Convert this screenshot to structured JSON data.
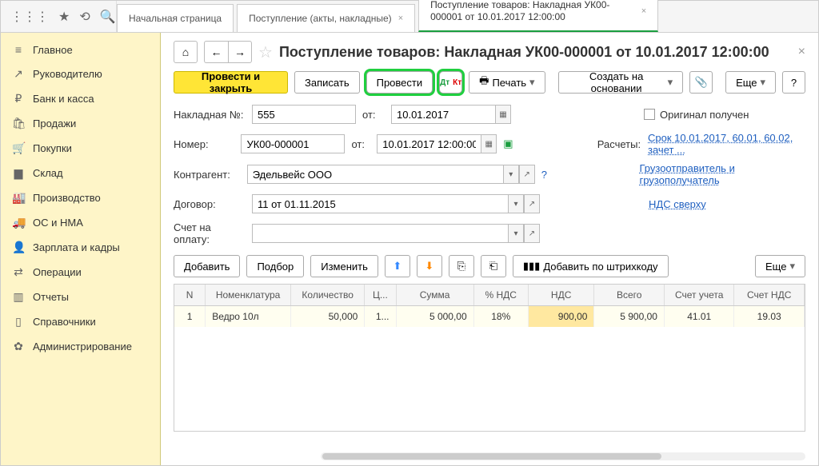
{
  "topbar": {
    "icons": [
      "⋮⋮⋮",
      "★",
      "⟲",
      "🔍"
    ]
  },
  "tabs": [
    {
      "label": "Начальная страница"
    },
    {
      "label": "Поступление (акты, накладные)"
    },
    {
      "label": "Поступление товаров: Накладная УК00-000001 от 10.01.2017 12:00:00",
      "active": true
    }
  ],
  "sidebar": {
    "items": [
      {
        "icon": "≡",
        "label": "Главное"
      },
      {
        "icon": "↗",
        "label": "Руководителю"
      },
      {
        "icon": "₽",
        "label": "Банк и касса"
      },
      {
        "icon": "🛍",
        "label": "Продажи"
      },
      {
        "icon": "🛒",
        "label": "Покупки"
      },
      {
        "icon": "▆",
        "label": "Склад"
      },
      {
        "icon": "🏭",
        "label": "Производство"
      },
      {
        "icon": "🚚",
        "label": "ОС и НМА"
      },
      {
        "icon": "👤",
        "label": "Зарплата и кадры"
      },
      {
        "icon": "⇄",
        "label": "Операции"
      },
      {
        "icon": "▥",
        "label": "Отчеты"
      },
      {
        "icon": "▯",
        "label": "Справочники"
      },
      {
        "icon": "✿",
        "label": "Администрирование"
      }
    ]
  },
  "page": {
    "title": "Поступление товаров: Накладная УК00-000001 от 10.01.2017 12:00:00"
  },
  "toolbar": {
    "post_close": "Провести и закрыть",
    "save": "Записать",
    "post": "Провести",
    "dtkt": "Дт Кт",
    "print": "Печать",
    "create_based": "Создать на основании",
    "more": "Еще",
    "help": "?"
  },
  "form": {
    "invoice_label": "Накладная №:",
    "invoice_no": "555",
    "from_label": "от:",
    "invoice_date": "10.01.2017",
    "original_received": "Оригинал получен",
    "number_label": "Номер:",
    "number": "УК00-000001",
    "number_datetime": "10.01.2017 12:00:00",
    "settlements_label": "Расчеты:",
    "settlements_link": "Срок 10.01.2017, 60.01, 60.02, зачет ...",
    "counterparty_label": "Контрагент:",
    "counterparty": "Эдельвейс ООО",
    "shipper_link": "Грузоотправитель и грузополучатель",
    "contract_label": "Договор:",
    "contract": "11 от 01.11.2015",
    "vat_link": "НДС сверху",
    "bill_label": "Счет на оплату:",
    "bill": ""
  },
  "table_toolbar": {
    "add": "Добавить",
    "select": "Подбор",
    "change": "Изменить",
    "barcode": "Добавить по штрихкоду",
    "more": "Еще"
  },
  "table": {
    "headers": {
      "n": "N",
      "nom": "Номенклатура",
      "qty": "Количество",
      "price": "Ц...",
      "sum": "Сумма",
      "vatp": "% НДС",
      "vat": "НДС",
      "total": "Всего",
      "acc": "Счет учета",
      "vacc": "Счет НДС"
    },
    "rows": [
      {
        "n": "1",
        "nom": "Ведро 10л",
        "qty": "50,000",
        "price": "1...",
        "sum": "5 000,00",
        "vatp": "18%",
        "vat": "900,00",
        "total": "5 900,00",
        "acc": "41.01",
        "vacc": "19.03"
      }
    ]
  }
}
